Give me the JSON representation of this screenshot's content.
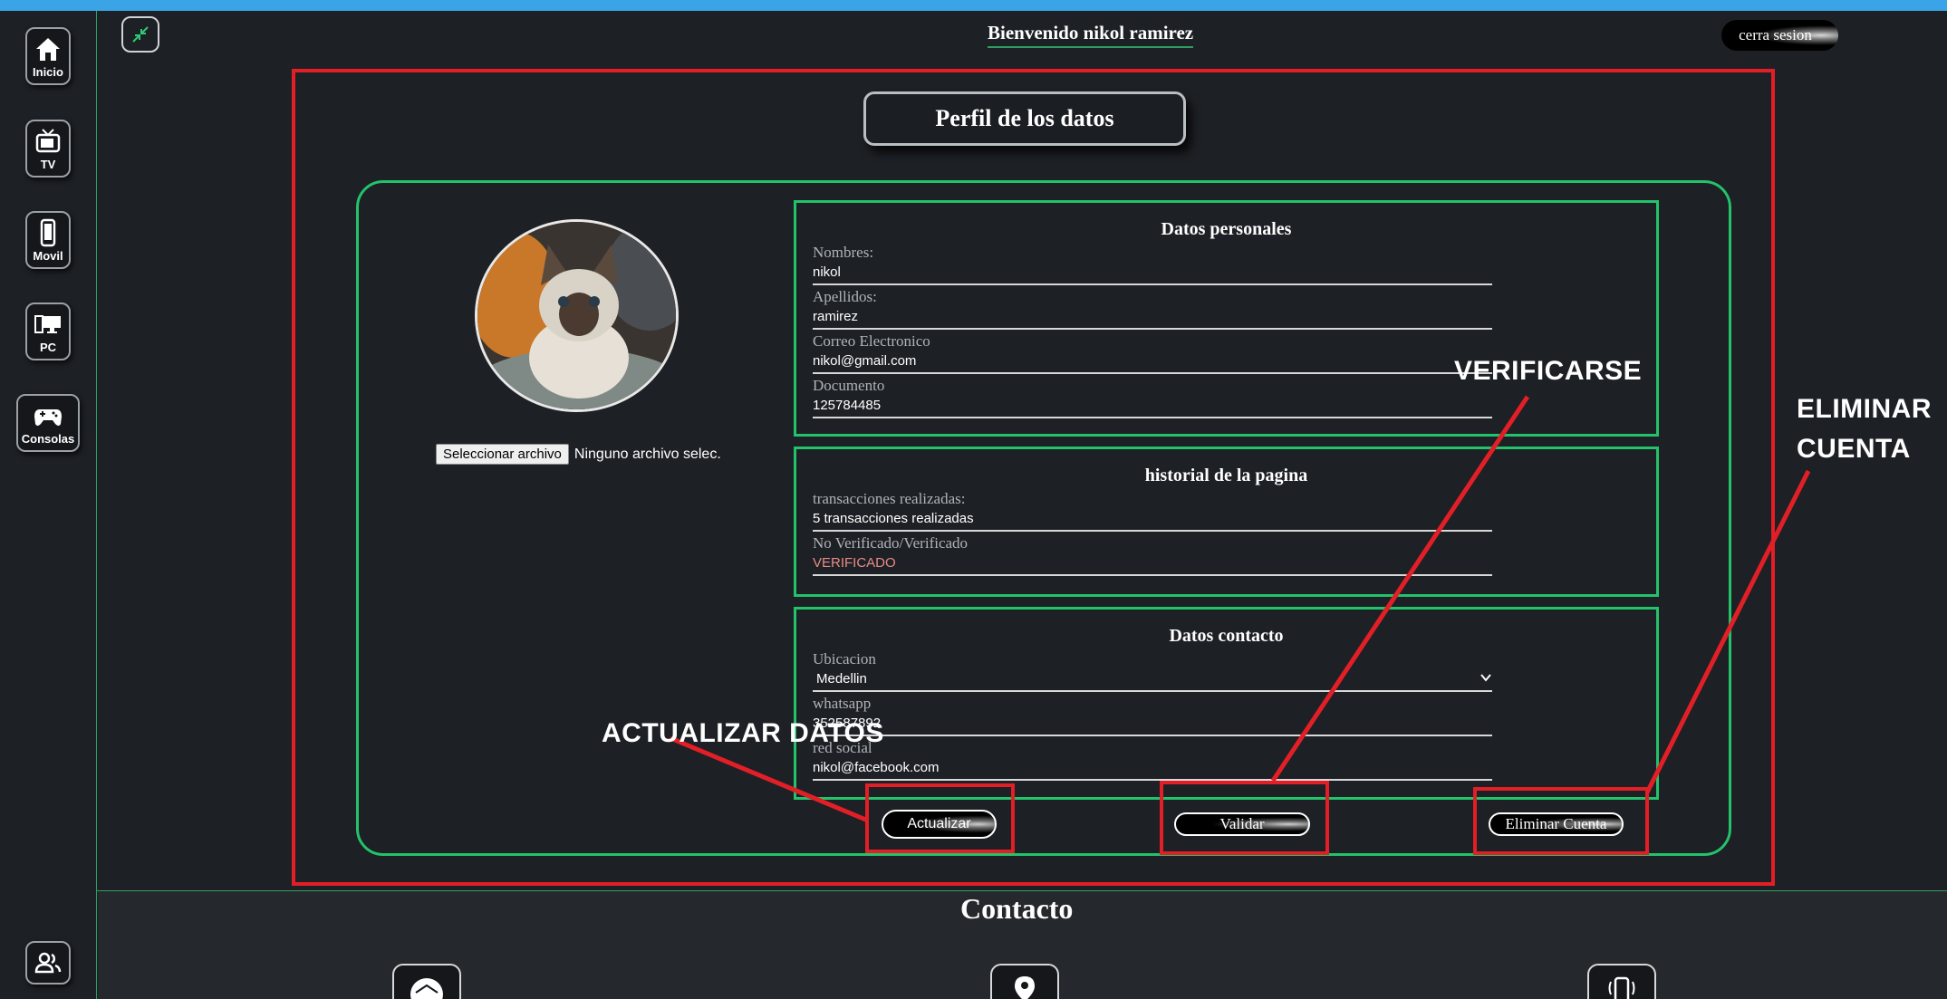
{
  "sidebar": {
    "items": [
      {
        "label": "Inicio",
        "icon": "home-icon"
      },
      {
        "label": "TV",
        "icon": "tv-icon"
      },
      {
        "label": "Movil",
        "icon": "phone-icon"
      },
      {
        "label": "PC",
        "icon": "pc-icon"
      },
      {
        "label": "Consolas",
        "icon": "gamepad-icon"
      }
    ],
    "bottom_icon": "users-icon"
  },
  "header": {
    "welcome": "Bienvenido nikol ramirez",
    "logout_label": "cerra sesion"
  },
  "profile": {
    "title": "Perfil de los datos",
    "file_button": "Seleccionar archivo",
    "file_status": "Ninguno archivo selec.",
    "personal": {
      "heading": "Datos personales",
      "fields": [
        {
          "label": "Nombres:",
          "value": "nikol"
        },
        {
          "label": "Apellidos:",
          "value": "ramirez"
        },
        {
          "label": "Correo Electronico",
          "value": "nikol@gmail.com"
        },
        {
          "label": "Documento",
          "value": "125784485"
        }
      ]
    },
    "history": {
      "heading": "historial de la pagina",
      "fields": [
        {
          "label": "transacciones realizadas:",
          "value": "5 transacciones realizadas"
        },
        {
          "label": "No Verificado/Verificado",
          "value": "VERIFICADO"
        }
      ]
    },
    "contact": {
      "heading": "Datos contacto",
      "location_label": "Ubicacion",
      "location_value": "Medellin",
      "whatsapp_label": "whatsapp",
      "whatsapp_value": "352587892",
      "social_label": "red social",
      "social_value": "nikol@facebook.com"
    },
    "buttons": {
      "update": "Actualizar",
      "validate": "Validar",
      "delete": "Eliminar Cuenta"
    }
  },
  "annotations": {
    "update": "ACTUALIZAR DATOS",
    "verify": "VERIFICARSE",
    "delete_line1": "ELIMINAR",
    "delete_line2": "CUENTA"
  },
  "footer": {
    "title": "Contacto",
    "icons": [
      "mail-icon",
      "location-pin-icon",
      "phone-ring-icon"
    ]
  },
  "colors": {
    "background": "#1d2025",
    "accent_green": "#23c26b",
    "annotation_red": "#e21f26",
    "top_bar": "#3ba4e6",
    "verified_text": "#e88b86"
  }
}
